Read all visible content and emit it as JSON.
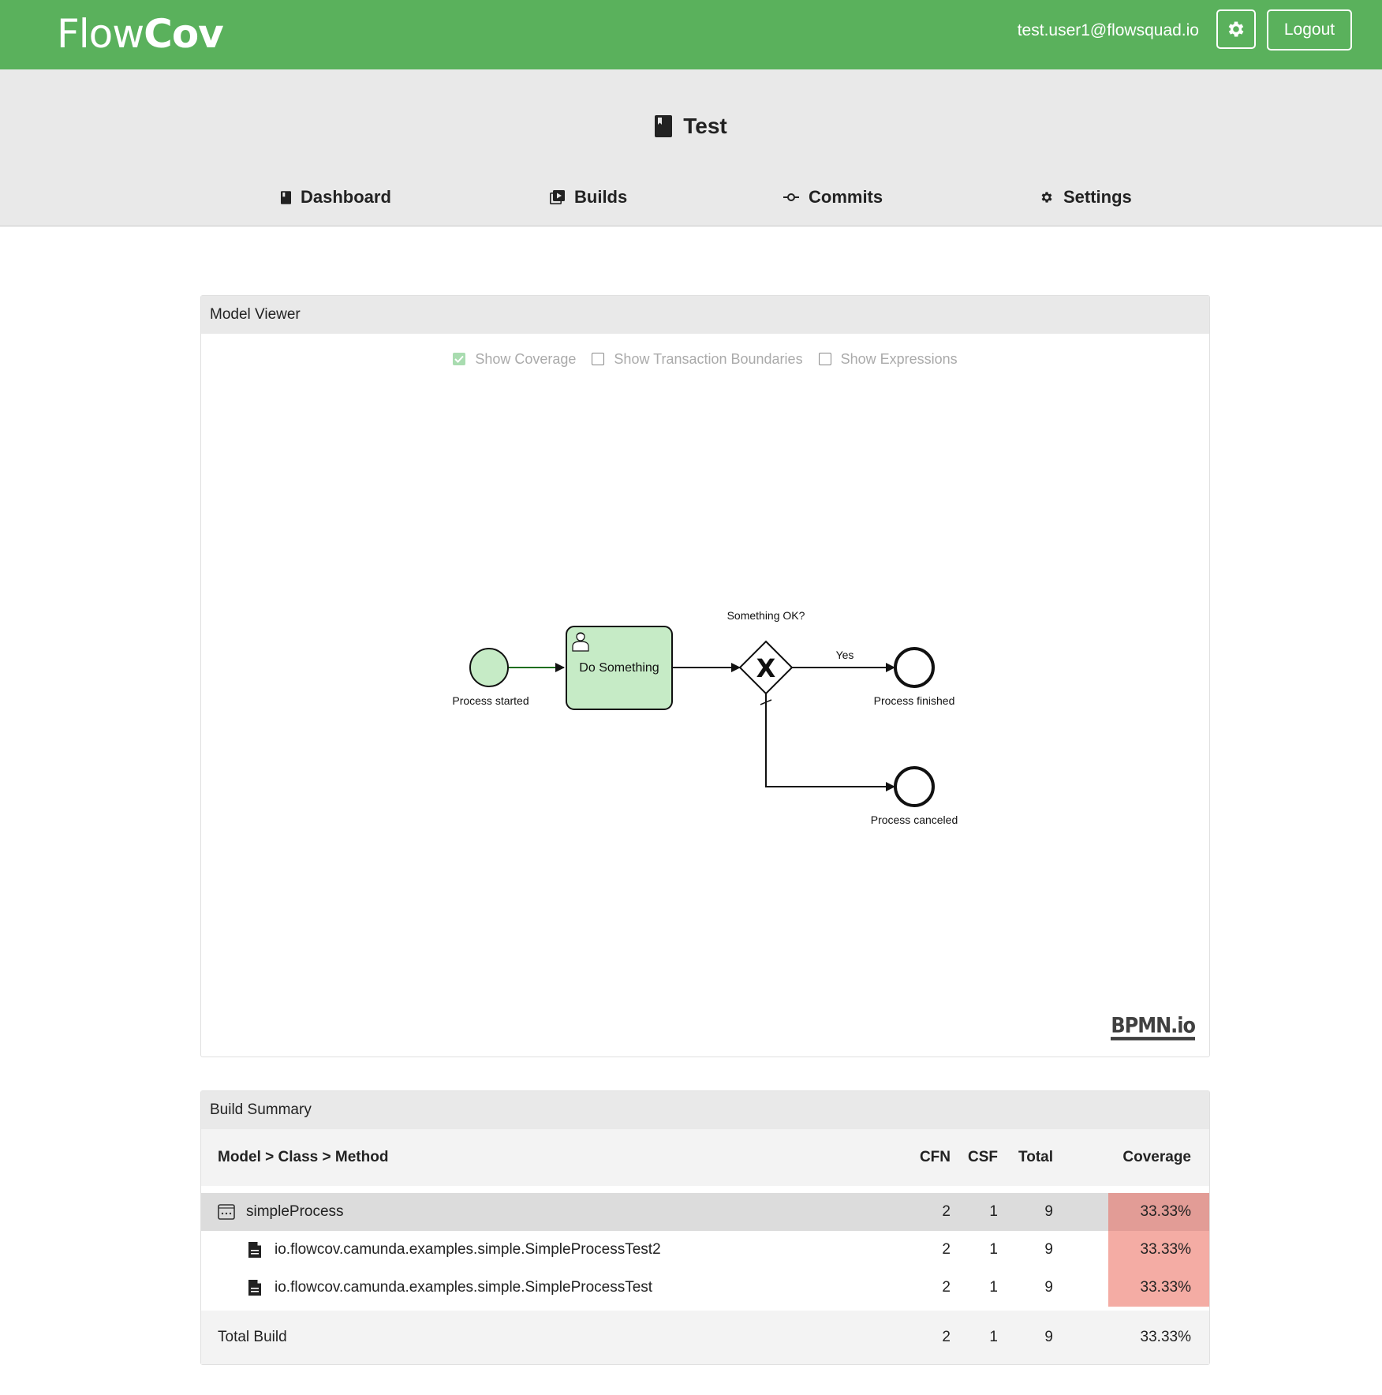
{
  "topbar": {
    "logo_light": "Flow",
    "logo_bold": "Cov",
    "user_email": "test.user1@flowsquad.io",
    "logout_label": "Logout",
    "background_color": "#5ab15c"
  },
  "project": {
    "icon": "book-icon",
    "title": "Test"
  },
  "nav": {
    "items": [
      {
        "label": "Dashboard",
        "icon": "book-icon"
      },
      {
        "label": "Builds",
        "icon": "builds-icon"
      },
      {
        "label": "Commits",
        "icon": "commit-icon"
      },
      {
        "label": "Settings",
        "icon": "gear-icon"
      }
    ]
  },
  "model_viewer": {
    "title": "Model Viewer",
    "toggles": [
      {
        "label": "Show Coverage",
        "checked": true
      },
      {
        "label": "Show Transaction Boundaries",
        "checked": false
      },
      {
        "label": "Show Expressions",
        "checked": false
      }
    ],
    "diagram": {
      "start_event": "Process started",
      "task": "Do Something",
      "gateway": "Something OK?",
      "flow_yes": "Yes",
      "end_finished": "Process finished",
      "end_canceled": "Process canceled",
      "gateway_marker": "X",
      "covered_color": "#c6ebc6"
    },
    "watermark": "BPMN.io"
  },
  "build_summary": {
    "title": "Build Summary",
    "columns": [
      "Model > Class > Method",
      "CFN",
      "CSF",
      "Total",
      "Coverage"
    ],
    "rows": [
      {
        "name": "simpleProcess",
        "icon": "model-icon",
        "cfn": "2",
        "csf": "1",
        "total": "9",
        "coverage": "33.33%"
      },
      {
        "name": "io.flowcov.camunda.examples.simple.SimpleProcessTest2",
        "icon": "file-icon",
        "cfn": "2",
        "csf": "1",
        "total": "9",
        "coverage": "33.33%"
      },
      {
        "name": "io.flowcov.camunda.examples.simple.SimpleProcessTest",
        "icon": "file-icon",
        "cfn": "2",
        "csf": "1",
        "total": "9",
        "coverage": "33.33%"
      }
    ],
    "total_row": {
      "label": "Total Build",
      "cfn": "2",
      "csf": "1",
      "total": "9",
      "coverage": "33.33%"
    },
    "colors": {
      "model_row": "#dcdcdc",
      "model_coverage": "#e29c96",
      "class_coverage": "#f4aca4"
    }
  }
}
